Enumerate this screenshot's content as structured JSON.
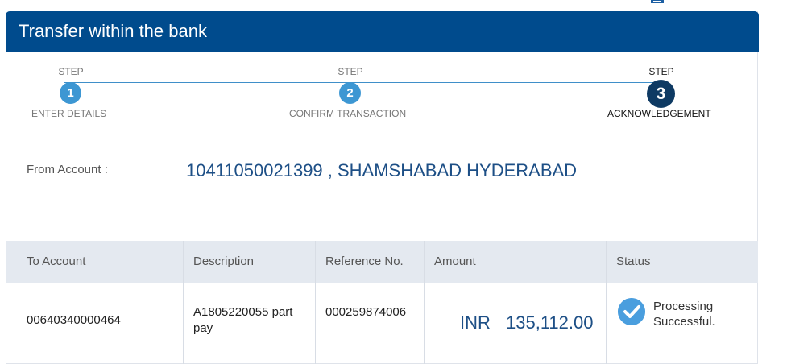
{
  "panel": {
    "title": "Transfer within the bank"
  },
  "stepper": {
    "step_word": "STEP",
    "steps": [
      {
        "number": "1",
        "label": "ENTER DETAILS",
        "state": "done"
      },
      {
        "number": "2",
        "label": "CONFIRM TRANSACTION",
        "state": "done"
      },
      {
        "number": "3",
        "label": "ACKNOWLEDGEMENT",
        "state": "active"
      }
    ]
  },
  "from_account": {
    "label": "From Account :",
    "value": "10411050021399 , SHAMSHABAD HYDERABAD"
  },
  "table": {
    "headers": [
      "To Account",
      "Description",
      "Reference No.",
      "Amount",
      "Status"
    ],
    "row": {
      "to_account": "00640340000464",
      "description_line1": "A1805220055 part",
      "description_line2": "pay",
      "reference_no": "000259874006",
      "currency": "INR",
      "amount": "135,112.00",
      "status_line1": "Processing",
      "status_line2": "Successful."
    }
  },
  "colors": {
    "header_bg": "#004b8d",
    "step_done": "#3d97d3",
    "step_active": "#0e3a63",
    "accent_text": "#1d4f86",
    "status_check": "#4a9ede"
  }
}
